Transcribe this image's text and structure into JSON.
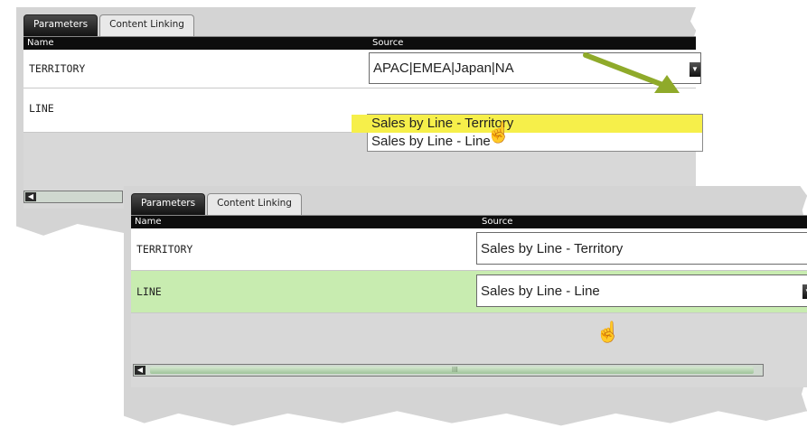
{
  "colors": {
    "header_bg": "#0d0d0d",
    "highlight_yellow": "#f6ef4a",
    "selected_row_green": "#c8ecb0",
    "annotation_arrow": "#8faa2a",
    "panel_bg": "#d4d4d4"
  },
  "panel_top": {
    "tabs": [
      {
        "label": "Parameters",
        "active": true
      },
      {
        "label": "Content Linking",
        "active": false
      }
    ],
    "columns": {
      "name": "Name",
      "source": "Source"
    },
    "rows": [
      {
        "name": "TERRITORY",
        "source": "APAC|EMEA|Japan|NA"
      },
      {
        "name": "LINE",
        "source": ""
      }
    ],
    "dropdown_options": [
      {
        "label": "Sales by Line - Territory",
        "highlighted": true
      },
      {
        "label": "Sales by Line - Line",
        "highlighted": false
      }
    ],
    "scroll_left_icon": "chevron-left-icon",
    "dropdown_icon": "chevron-down-icon"
  },
  "panel_bottom": {
    "tabs": [
      {
        "label": "Parameters",
        "active": true
      },
      {
        "label": "Content Linking",
        "active": false
      }
    ],
    "columns": {
      "name": "Name",
      "source": "Source"
    },
    "rows": [
      {
        "name": "TERRITORY",
        "source": "Sales by Line - Territory",
        "selected": false
      },
      {
        "name": "LINE",
        "source": "Sales by Line - Line",
        "selected": true
      }
    ],
    "scroll_grip": "III",
    "scroll_left_icon": "chevron-left-icon",
    "dropdown_icon": "chevron-down-icon"
  },
  "annotations": {
    "arrow_icon": "annotation-arrow-icon",
    "cursor_icon": "hand-pointer-icon"
  }
}
